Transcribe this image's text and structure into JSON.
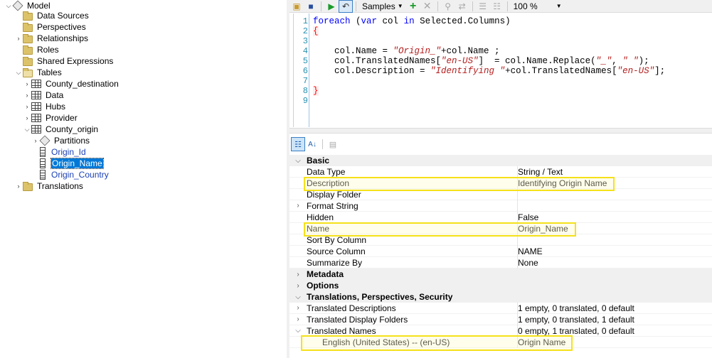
{
  "tree": {
    "root": "Model",
    "items": {
      "data_sources": "Data Sources",
      "perspectives": "Perspectives",
      "relationships": "Relationships",
      "roles": "Roles",
      "shared_expressions": "Shared Expressions",
      "tables": "Tables",
      "county_destination": "County_destination",
      "data": "Data",
      "hubs": "Hubs",
      "provider": "Provider",
      "county_origin": "County_origin",
      "partitions": "Partitions",
      "origin_id": "Origin_Id",
      "origin_name": "Origin_Name",
      "origin_country": "Origin_Country",
      "translations": "Translations"
    }
  },
  "toolbar": {
    "samples_label": "Samples",
    "zoom_value": "100 %"
  },
  "editor": {
    "line_numbers": [
      "1",
      "2",
      "3",
      "4",
      "5",
      "6",
      "7",
      "8",
      "9"
    ],
    "lines": {
      "l1_kw1": "foreach",
      "l1_mid1": " (",
      "l1_kw2": "var",
      "l1_mid2": " col ",
      "l1_kw3": "in",
      "l1_rest": " Selected.Columns)",
      "l2": "{",
      "l4_a": "    col.Name = ",
      "l4_str": "\"Origin_\"",
      "l4_b": "+col.Name ;",
      "l5_a": "    col.TranslatedNames[",
      "l5_str1": "\"en-US\"",
      "l5_b": "]  = col.Name.Replace(",
      "l5_str2": "\"_\"",
      "l5_c": ", ",
      "l5_str3": "\" \"",
      "l5_d": ");",
      "l6_a": "    col.Description = ",
      "l6_str1": "\"Identifying \"",
      "l6_b": "+col.TranslatedNames[",
      "l6_str2": "\"en-US\"",
      "l6_c": "];",
      "l8": "}"
    }
  },
  "properties": {
    "categories": {
      "basic": "Basic",
      "metadata": "Metadata",
      "options": "Options",
      "translations": "Translations, Perspectives, Security"
    },
    "rows": {
      "data_type": {
        "name": "Data Type",
        "value": "String / Text"
      },
      "description": {
        "name": "Description",
        "value": "Identifying Origin Name"
      },
      "display_folder": {
        "name": "Display Folder",
        "value": ""
      },
      "format_string": {
        "name": "Format String",
        "value": ""
      },
      "hidden": {
        "name": "Hidden",
        "value": "False"
      },
      "name": {
        "name": "Name",
        "value": "Origin_Name"
      },
      "sort_by_column": {
        "name": "Sort By Column",
        "value": ""
      },
      "source_column": {
        "name": "Source Column",
        "value": "NAME"
      },
      "summarize_by": {
        "name": "Summarize By",
        "value": "None"
      },
      "translated_descriptions": {
        "name": "Translated Descriptions",
        "value": "1 empty, 0 translated, 0 default"
      },
      "translated_display_folders": {
        "name": "Translated Display Folders",
        "value": "1 empty, 0 translated, 1 default"
      },
      "translated_names": {
        "name": "Translated Names",
        "value": "0 empty, 1 translated, 0 default"
      },
      "english": {
        "name": "English (United States) -- (en-US)",
        "value": "Origin Name"
      }
    }
  },
  "colors": {
    "highlight": "#f5e11a",
    "selection": "#0078d7",
    "keyword": "#0000ff",
    "string": "#b51d1d"
  }
}
